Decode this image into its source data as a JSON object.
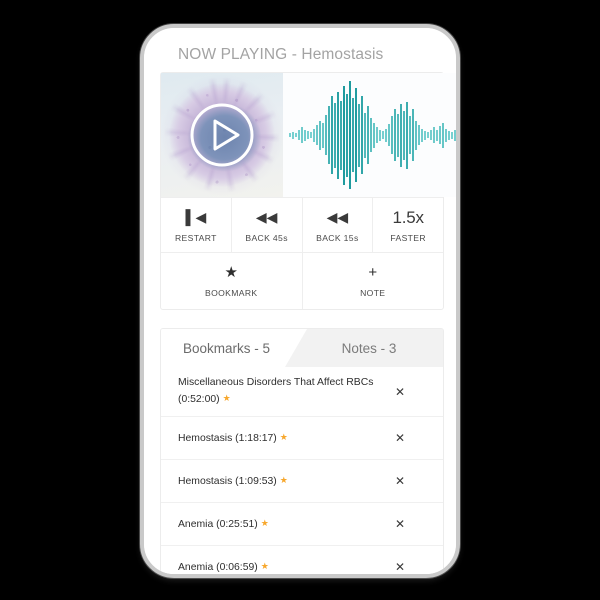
{
  "header": {
    "now_playing_label": "NOW PLAYING - Hemostasis"
  },
  "player": {
    "album_art_name": "cell-microscopy-artwork",
    "play_button_label": "play-button",
    "waveform_name": "audio-waveform",
    "waveform_color": "#3fbdbd"
  },
  "controls": [
    {
      "icon": "skip-to-start-icon",
      "glyph": "▌◀",
      "label": "RESTART"
    },
    {
      "icon": "rewind-icon",
      "glyph": "◀◀",
      "label": "BACK 45s"
    },
    {
      "icon": "rewind-icon",
      "glyph": "◀◀",
      "label": "BACK 15s"
    },
    {
      "icon": "playback-rate-icon",
      "glyph": "1.5x",
      "label": "FASTER"
    }
  ],
  "actions": [
    {
      "icon": "star-icon",
      "glyph": "★",
      "label": "BOOKMARK"
    },
    {
      "icon": "plus-icon",
      "glyph": "+",
      "label": "NOTE"
    }
  ],
  "tabs": [
    {
      "label": "Bookmarks - 5",
      "active": true
    },
    {
      "label": "Notes - 3",
      "active": false
    }
  ],
  "bookmarks": [
    {
      "text": "Miscellaneous Disorders That Affect RBCs (0:52:00)",
      "star": "★",
      "close": "✕"
    },
    {
      "text": "Hemostasis (1:18:17)",
      "star": "★",
      "close": "✕"
    },
    {
      "text": "Hemostasis (1:09:53)",
      "star": "★",
      "close": "✕"
    },
    {
      "text": "Anemia (0:25:51)",
      "star": "★",
      "close": "✕"
    },
    {
      "text": "Anemia (0:06:59)",
      "star": "★",
      "close": "✕"
    }
  ],
  "colors": {
    "star": "#f7a72c",
    "waveform": "#3fbdbd",
    "title": "#a3a3a3",
    "frame": "#c9c9c9"
  }
}
